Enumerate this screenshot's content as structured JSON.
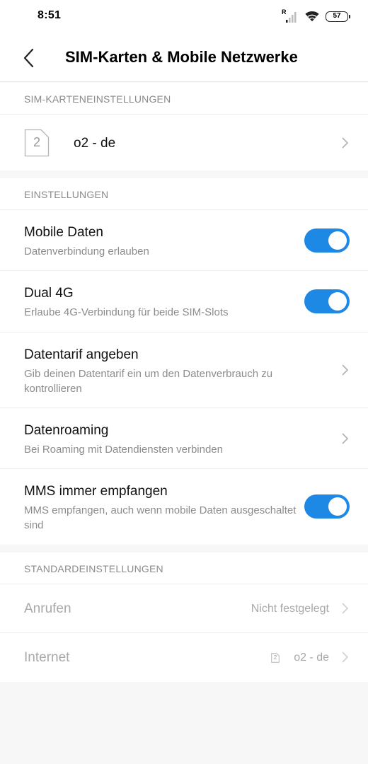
{
  "status_bar": {
    "time": "8:51",
    "roaming": "R",
    "battery": "57"
  },
  "header": {
    "title": "SIM-Karten & Mobile Netzwerke",
    "back_icon": "chevron-left-icon"
  },
  "sim_section": {
    "header": "SIM-KARTENEINSTELLUNGEN",
    "sim": {
      "slot": "2",
      "name": "o2 - de"
    }
  },
  "settings_section": {
    "header": "EINSTELLUNGEN",
    "items": [
      {
        "title": "Mobile Daten",
        "subtitle": "Datenverbindung erlauben",
        "control": "toggle",
        "on": true
      },
      {
        "title": "Dual 4G",
        "subtitle": "Erlaube 4G-Verbindung für beide SIM-Slots",
        "control": "toggle",
        "on": true
      },
      {
        "title": "Datentarif angeben",
        "subtitle": "Gib deinen Datentarif ein um den Datenverbrauch zu kontrollieren",
        "control": "chevron"
      },
      {
        "title": "Datenroaming",
        "subtitle": "Bei Roaming mit Datendiensten verbinden",
        "control": "chevron"
      },
      {
        "title": "MMS immer empfangen",
        "subtitle": "MMS empfangen, auch wenn mobile Daten ausgeschaltet sind",
        "control": "toggle",
        "on": true
      }
    ]
  },
  "default_section": {
    "header": "STANDARDEINSTELLUNGEN",
    "items": [
      {
        "title": "Anrufen",
        "value": "Nicht festgelegt"
      },
      {
        "title": "Internet",
        "value": "o2 - de",
        "sim_slot": "2"
      }
    ]
  },
  "colors": {
    "accent": "#1e88e5",
    "background": "#f7f7f7",
    "secondary_text": "#8c8c8c",
    "disabled_text": "#a8a8a8"
  }
}
